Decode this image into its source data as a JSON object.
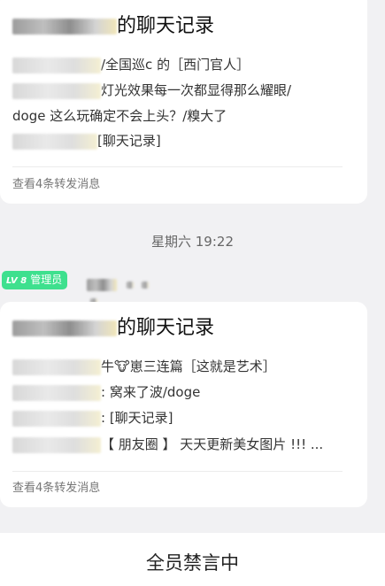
{
  "messages": [
    {
      "title_suffix": "的聊天记录",
      "lines": [
        {
          "text": "/全国巡c 的［西门官人］"
        },
        {
          "text": "灯光效果每一次都显得那么耀眼/"
        },
        {
          "text": "doge 这么玩确定不会上头？/糗大了"
        },
        {
          "text": "[聊天记录]"
        }
      ],
      "footer": "查看4条转发消息"
    },
    {
      "title_suffix": "的聊天记录",
      "lines": [
        {
          "text": "牛🐮崽三连篇［这就是艺术］"
        },
        {
          "text": ": 窝来了波/doge"
        },
        {
          "text": ": [聊天记录]"
        },
        {
          "text": "【 朋友圈 】 天天更新美女图片 !!! ..."
        }
      ],
      "footer": "查看4条转发消息"
    }
  ],
  "timestamp": "星期六 19:22",
  "sender": {
    "level": "LV 8",
    "role": "管理员"
  },
  "bottom": {
    "status": "全员禁言中"
  },
  "colors": {
    "badge": "#3ee08e",
    "background": "#f1f1f3",
    "card": "#ffffff"
  }
}
